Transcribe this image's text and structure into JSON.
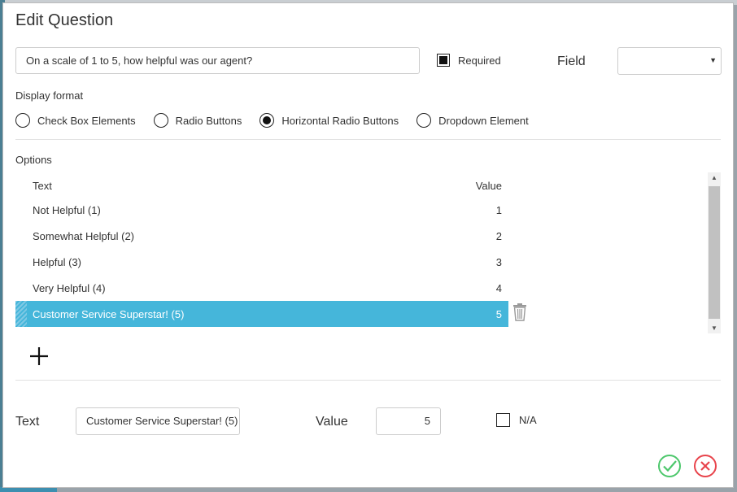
{
  "dialog": {
    "title": "Edit Question"
  },
  "question": {
    "value": "On a scale of 1 to 5, how helpful was our agent?"
  },
  "required": {
    "label": "Required",
    "checked": true
  },
  "field": {
    "label": "Field",
    "value": ""
  },
  "display_format": {
    "label": "Display format",
    "options": [
      {
        "label": "Check Box Elements",
        "selected": false
      },
      {
        "label": "Radio Buttons",
        "selected": false
      },
      {
        "label": "Horizontal Radio Buttons",
        "selected": true
      },
      {
        "label": "Dropdown Element",
        "selected": false
      }
    ]
  },
  "options": {
    "label": "Options",
    "headers": {
      "text": "Text",
      "value": "Value"
    },
    "rows": [
      {
        "text": "Not Helpful (1)",
        "value": "1"
      },
      {
        "text": "Somewhat Helpful (2)",
        "value": "2"
      },
      {
        "text": "Helpful (3)",
        "value": "3"
      },
      {
        "text": "Very Helpful (4)",
        "value": "4"
      },
      {
        "text": "Customer Service Superstar! (5)",
        "value": "5",
        "selected": true
      }
    ]
  },
  "editor": {
    "text_label": "Text",
    "text_value": "Customer Service Superstar! (5)",
    "value_label": "Value",
    "value_value": "5",
    "na_label": "N/A",
    "na_checked": false
  },
  "icons": {
    "trash": "trash-icon",
    "add": "plus-icon",
    "confirm": "check-circle-icon",
    "cancel": "x-circle-icon"
  },
  "colors": {
    "selected_row": "#45b6da",
    "confirm": "#4cc76b",
    "cancel": "#e8434b"
  }
}
